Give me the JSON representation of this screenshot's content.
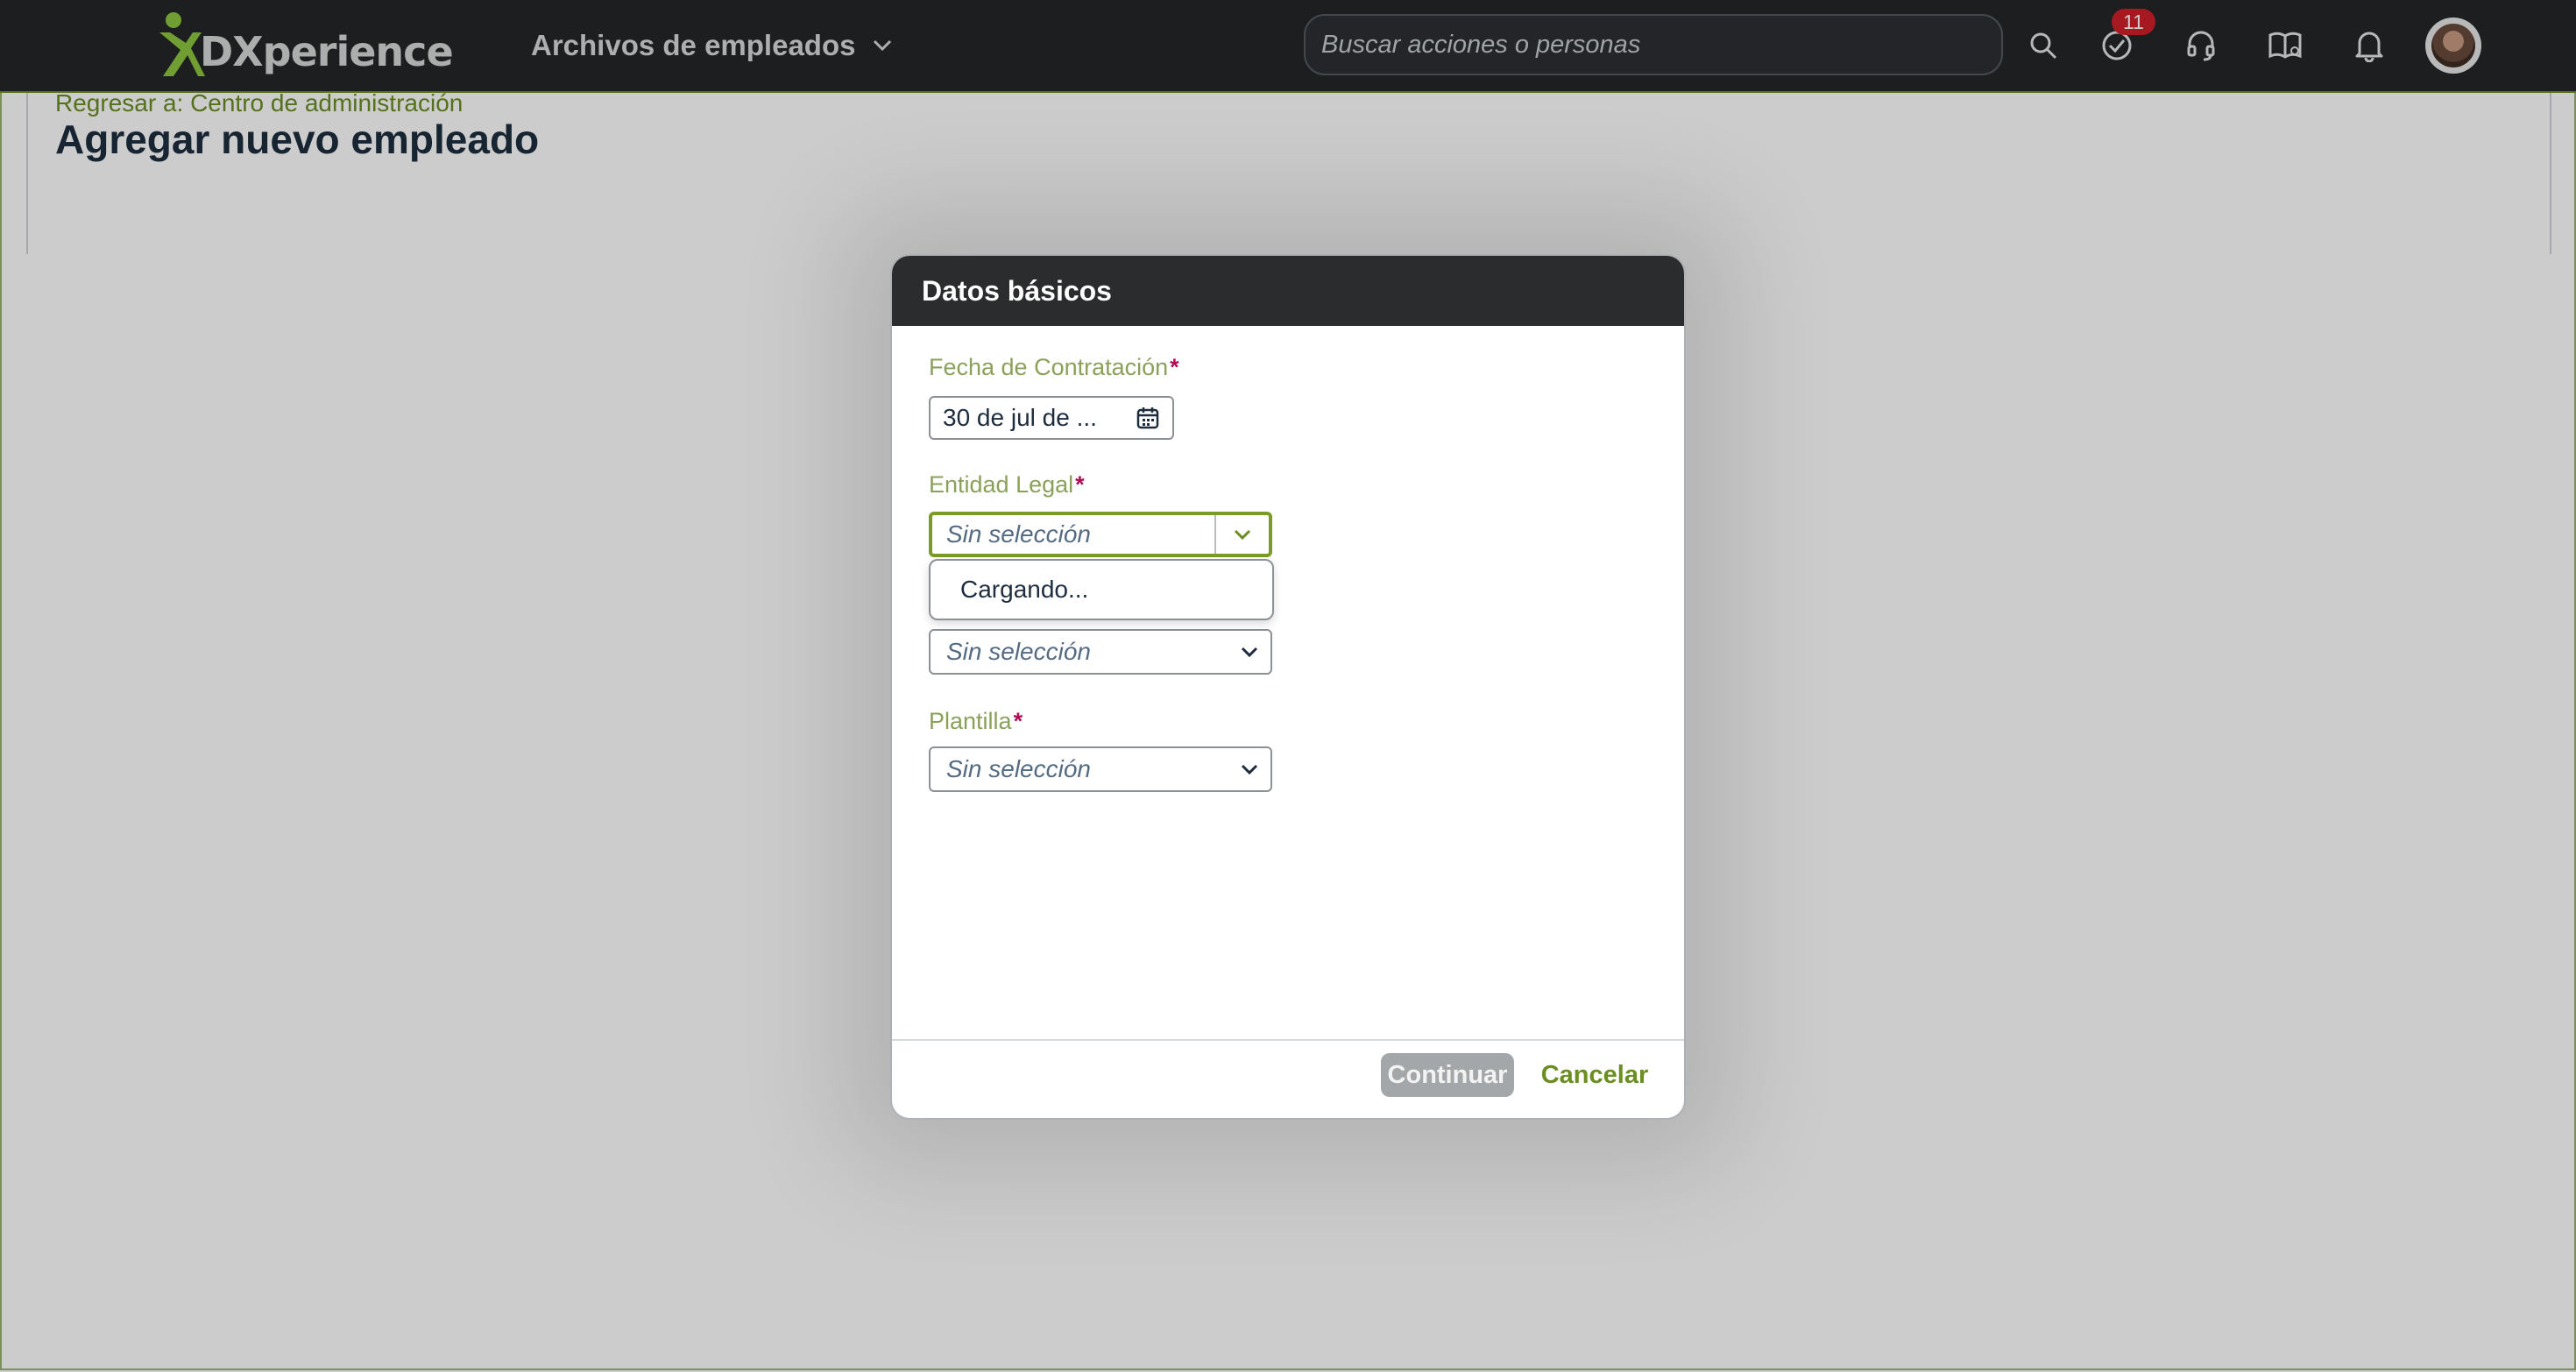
{
  "shell": {
    "logo_text": "DXperience",
    "product_switch_label": "Archivos de empleados",
    "search_placeholder": "Buscar acciones o personas",
    "todo_badge": "11",
    "icons": [
      "search-icon",
      "todo-check-icon",
      "headset-support-icon",
      "learning-book-icon",
      "notification-bell-icon"
    ]
  },
  "page": {
    "back_link": "Regresar a: Centro de administración",
    "title": "Agregar nuevo empleado"
  },
  "dialog": {
    "title": "Datos básicos",
    "fields": {
      "hire_date": {
        "label": "Fecha de Contratación",
        "required_mark": "*",
        "value": "30 de jul de ..."
      },
      "legal_entity": {
        "label": "Entidad Legal",
        "required_mark": "*",
        "placeholder": "Sin selección"
      },
      "hidden_field": {
        "placeholder": "Sin selección"
      },
      "template": {
        "label": "Plantilla",
        "required_mark": "*",
        "placeholder": "Sin selección"
      }
    },
    "dropdown_loading": "Cargando...",
    "buttons": {
      "continue": "Continuar",
      "cancel": "Cancelar"
    }
  },
  "colors": {
    "accent": "#6b8e23",
    "shell_bg": "#232629",
    "required": "#b00b54",
    "badge": "#d21f2a"
  }
}
